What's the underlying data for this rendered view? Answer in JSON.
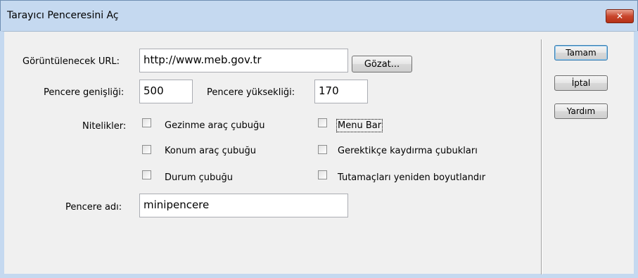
{
  "window": {
    "title": "Tarayıcı Penceresini Aç",
    "close_glyph": "✕"
  },
  "form": {
    "url_label": "Görüntülenecek URL:",
    "url_value": "http://www.meb.gov.tr",
    "browse_label": "Gözat...",
    "width_label": "Pencere genişliği:",
    "width_value": "500",
    "height_label": "Pencere yüksekliği:",
    "height_value": "170",
    "attributes_label": "Nitelikler:",
    "attributes": [
      {
        "label": "Gezinme araç çubuğu",
        "checked": false
      },
      {
        "label": "Menu Bar",
        "checked": false
      },
      {
        "label": "Konum araç çubuğu",
        "checked": false
      },
      {
        "label": "Gerektikçe kaydırma çubukları",
        "checked": false
      },
      {
        "label": "Durum çubuğu",
        "checked": false
      },
      {
        "label": "Tutamaçları yeniden boyutlandır",
        "checked": false
      }
    ],
    "name_label": "Pencere adı:",
    "name_value": "minipencere"
  },
  "buttons": {
    "ok": "Tamam",
    "cancel": "İptal",
    "help": "Yardım"
  }
}
